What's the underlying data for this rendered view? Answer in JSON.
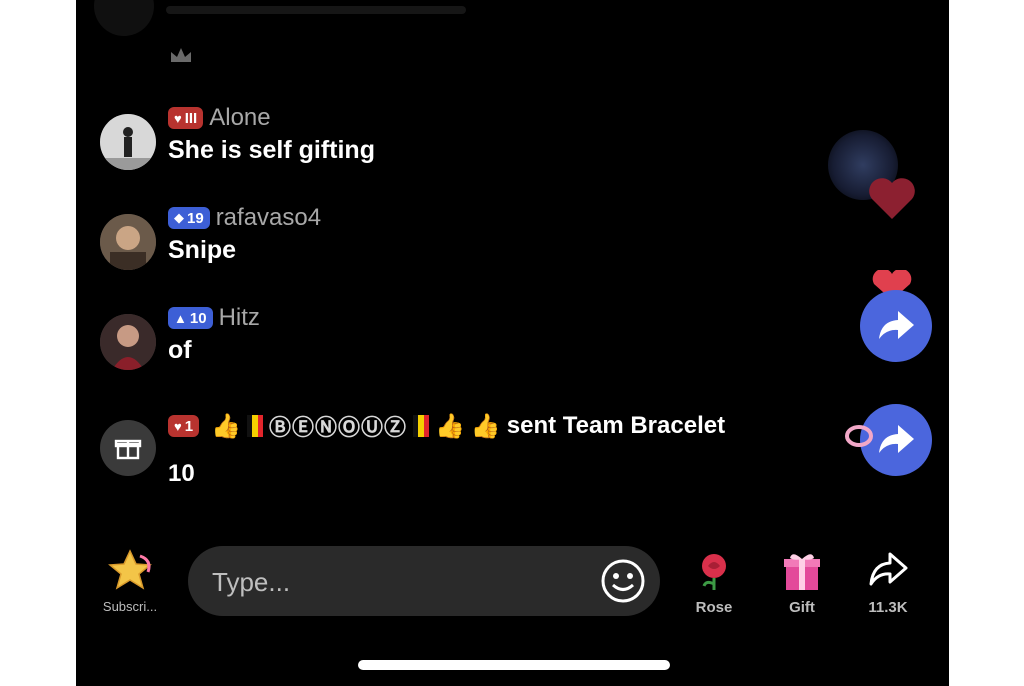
{
  "chat": [
    {
      "badge": "III",
      "badge_color": "#b8332f",
      "username": "Alone",
      "text": "She is self gifting"
    },
    {
      "badge": "19",
      "badge_color": "#3d5fd6",
      "username": "rafavaso4",
      "text": "Snipe"
    },
    {
      "badge": "10",
      "badge_color": "#3d5fd6",
      "username": "Hitz",
      "text": "of"
    }
  ],
  "gift_event": {
    "badge": "1",
    "badge_color": "#b8332f",
    "fancy_name": "ⒷⒺⓃⓄⓊⓏ",
    "action": "sent Team Bracelet",
    "count": "10"
  },
  "bottom_bar": {
    "subscribe_label": "Subscri...",
    "input_placeholder": "Type...",
    "rose_label": "Rose",
    "gift_label": "Gift",
    "share_count": "11.3K"
  },
  "colors": {
    "background": "#000000",
    "accent_blue": "#4b66dd",
    "badge_red": "#b8332f"
  },
  "icons": [
    "star-icon",
    "smile-icon",
    "rose-icon",
    "gift-box-icon",
    "share-arrow-icon",
    "gift-icon",
    "heart-icon"
  ]
}
